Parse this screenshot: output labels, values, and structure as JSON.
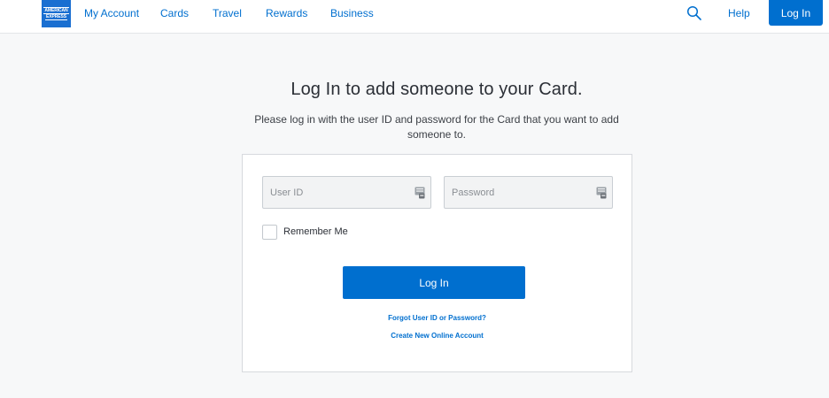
{
  "header": {
    "logo": {
      "line1": "AMERICAN",
      "line2": "EXPRESS"
    },
    "nav": [
      "My Account",
      "Cards",
      "Travel",
      "Rewards",
      "Business"
    ],
    "search_icon": "search-icon",
    "help_label": "Help",
    "login_label": "Log In"
  },
  "main": {
    "title": "Log In to add someone to your Card.",
    "subtitle": "Please log in with the user ID and password for the Card that you want to add someone to."
  },
  "login_form": {
    "user_id_placeholder": "User ID",
    "user_id_value": "",
    "password_placeholder": "Password",
    "password_value": "",
    "field_icon": "password-manager-icon",
    "remember_me_label": "Remember Me",
    "remember_me_checked": false,
    "submit_label": "Log In",
    "forgot_link": "Forgot User ID or Password?",
    "create_link": "Create New Online Account"
  },
  "colors": {
    "brand_blue": "#006fcf",
    "background": "#f7f8f9"
  }
}
